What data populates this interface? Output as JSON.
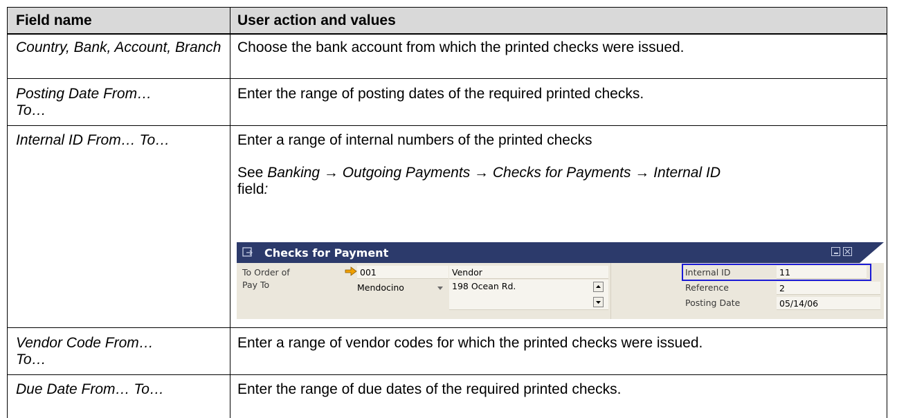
{
  "header": {
    "col1": "Field name",
    "col2": "User action and values"
  },
  "rows": [
    {
      "field": "Country, Bank, Account, Branch",
      "action": "Choose the bank account from which the printed checks were issued."
    },
    {
      "field": "Posting Date From… To…",
      "action": "Enter the range of posting dates of the required printed checks."
    },
    {
      "field": "Internal ID From… To…",
      "action": "Enter a range of internal numbers of the printed checks",
      "see_prefix": "See ",
      "see_path": "Banking → Outgoing Payments → Checks for Payments → Internal ID",
      "see_suffix_word": "field",
      "see_suffix_colon": ":"
    },
    {
      "field": "Vendor Code From… To…",
      "action": "Enter a range of vendor codes for which the printed checks were issued."
    },
    {
      "field": "Due Date From… To…",
      "action": "Enter the range of due dates of the required printed checks."
    }
  ],
  "sap_window": {
    "title": "Checks for Payment",
    "to_order_of_label": "To Order of",
    "to_order_of_value": "001",
    "vendor_value": "Vendor",
    "pay_to_label": "Pay To",
    "pay_to_value": "Mendocino",
    "address_value": "198 Ocean Rd.",
    "internal_id_label": "Internal ID",
    "internal_id_value": "11",
    "reference_label": "Reference",
    "reference_value": "2",
    "posting_date_label": "Posting Date",
    "posting_date_value": "05/14/06",
    "colors": {
      "title_bar": "#2c3a6b",
      "body": "#ebe7dc",
      "highlight": "#1a1ad6",
      "arrow": "#f0a000"
    }
  }
}
